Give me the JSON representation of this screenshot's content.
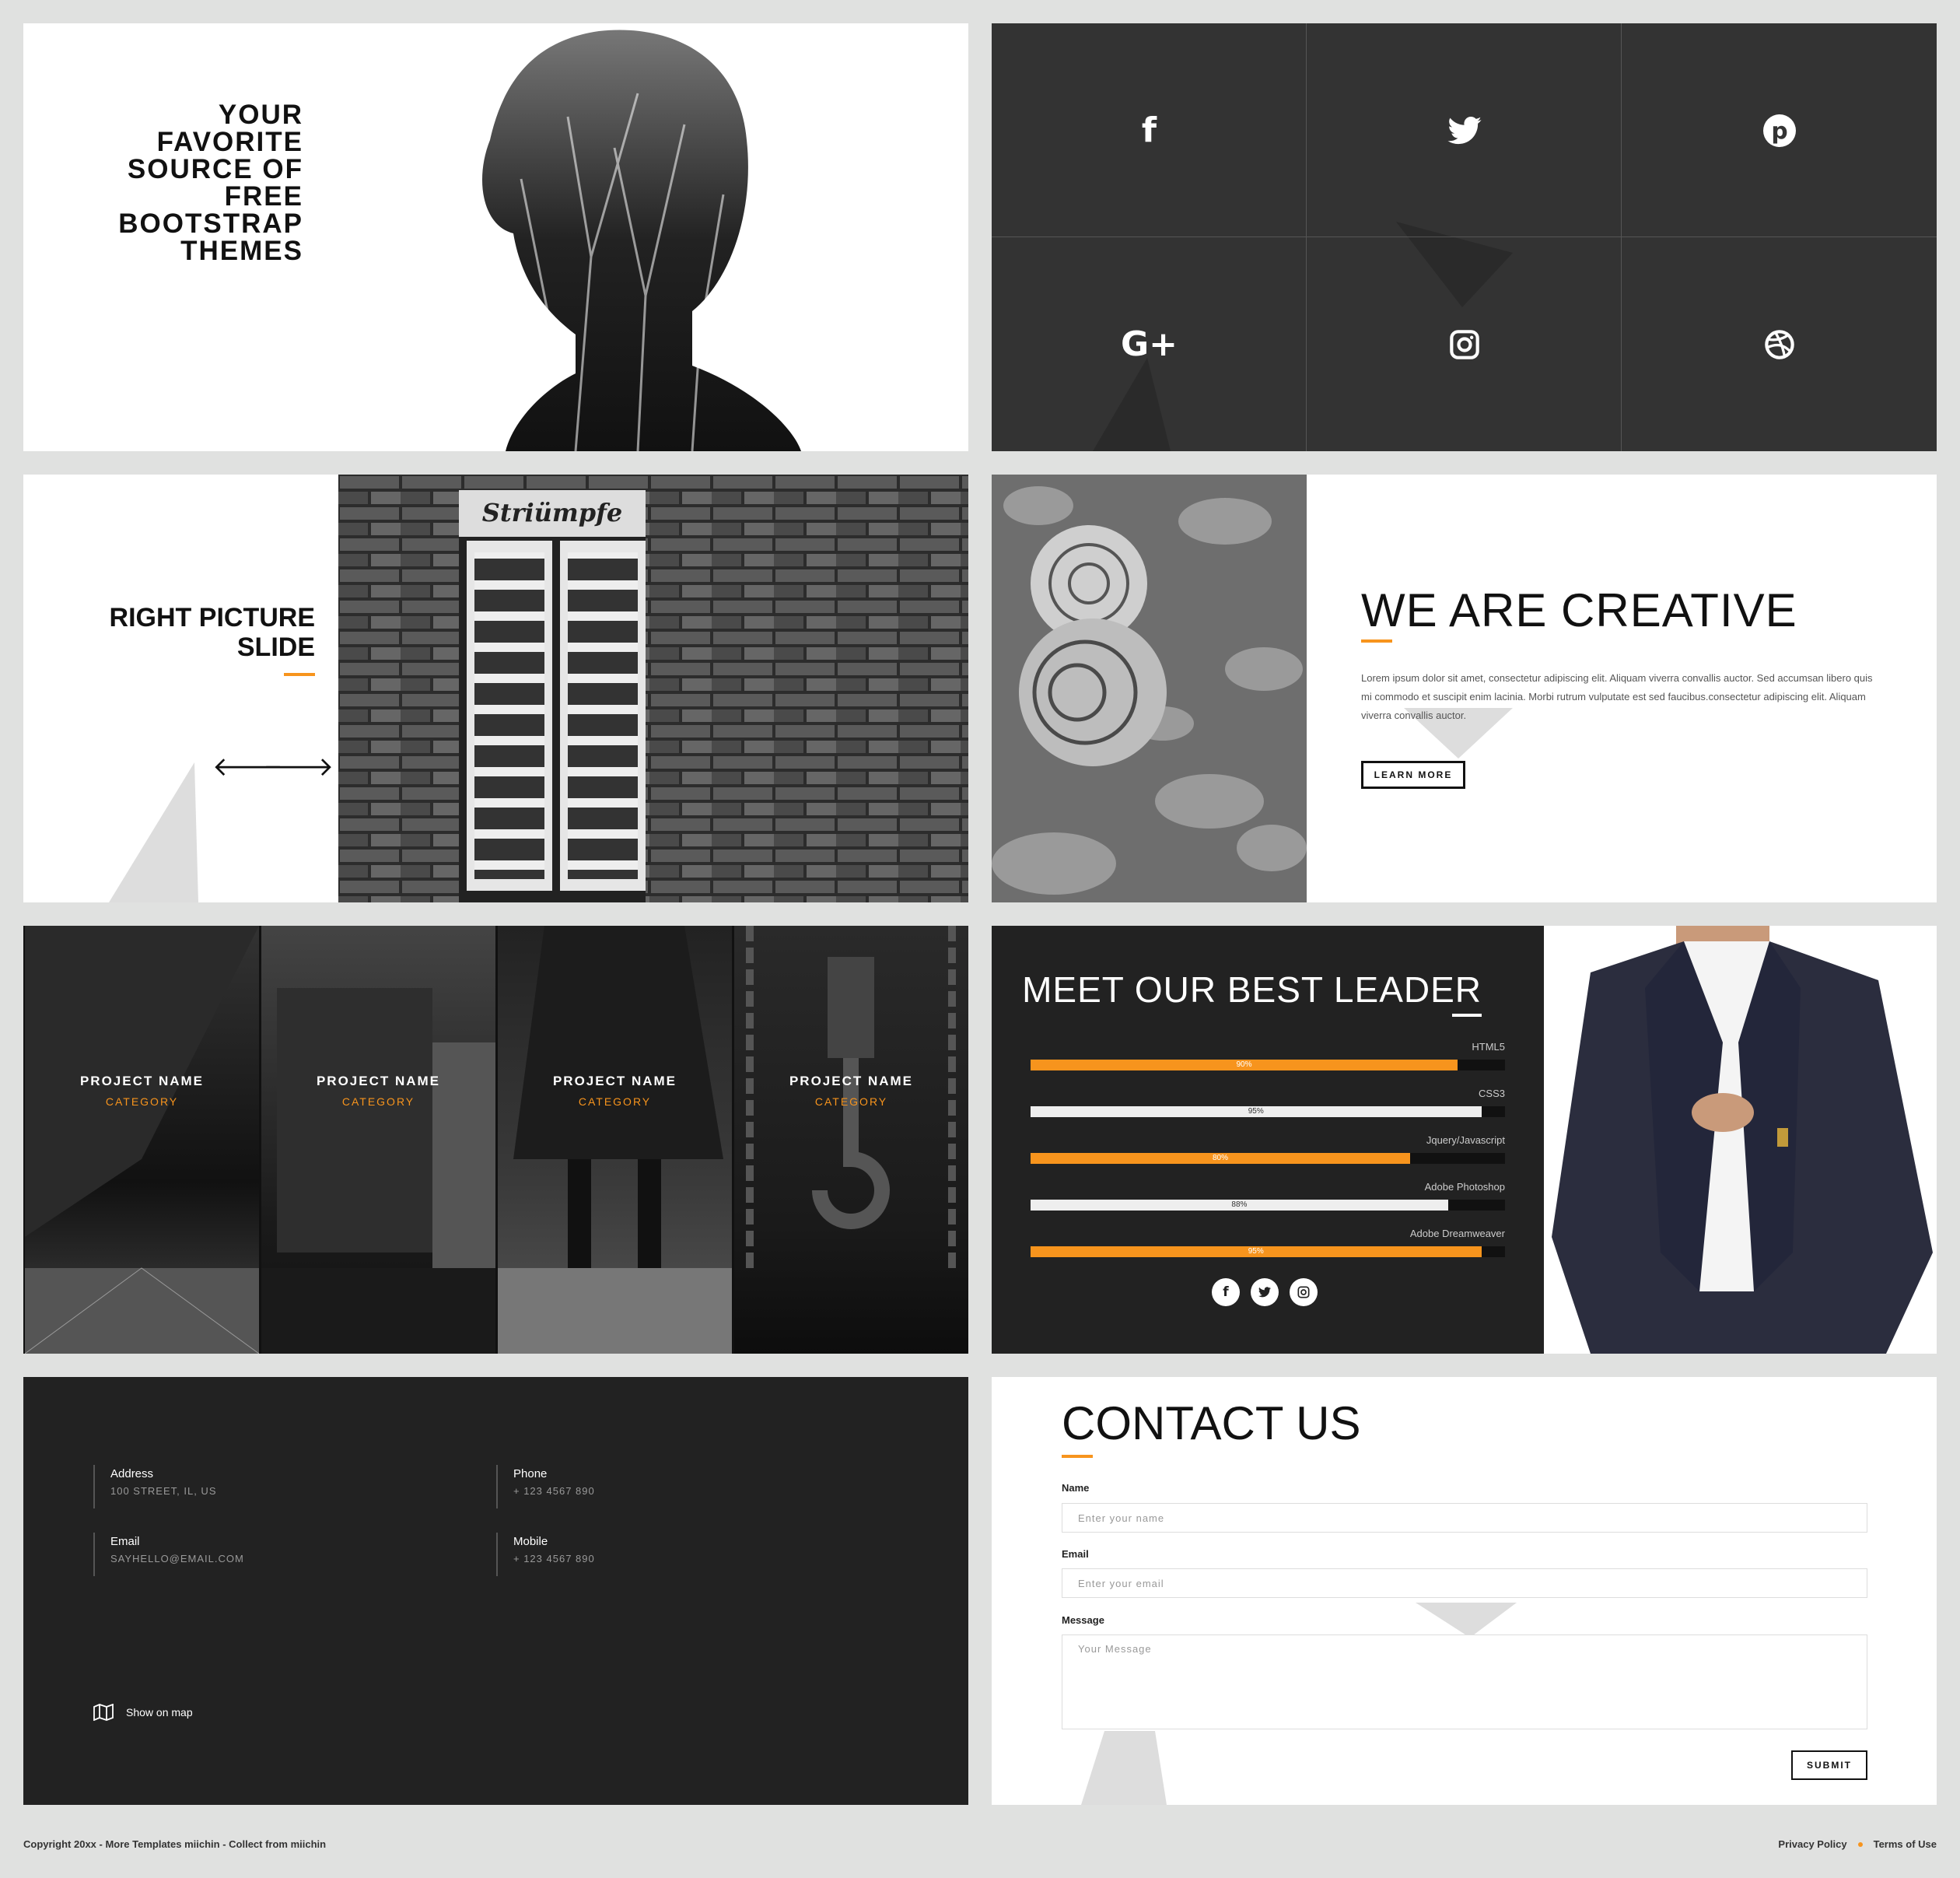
{
  "hero": {
    "title": "YOUR\nFAVORITE\nSOURCE OF\nFREE\nBOOTSTRAP\nTHEMES"
  },
  "social_grid": {
    "icons": [
      "facebook-icon",
      "twitter-icon",
      "pinterest-icon",
      "google-plus-icon",
      "instagram-icon",
      "dribbble-icon"
    ]
  },
  "right_slide": {
    "title": "RIGHT PICTURE\nSLIDE",
    "sign_text": "Striümpfe"
  },
  "creative": {
    "title": "WE ARE CREATIVE",
    "text": "Lorem ipsum dolor sit amet, consectetur adipiscing elit. Aliquam viverra convallis auctor. Sed accumsan libero quis mi commodo et suscipit enim lacinia. Morbi rutrum vulputate est sed faucibus.consectetur adipiscing elit. Aliquam viverra convallis auctor.",
    "button": "LEARN MORE"
  },
  "projects": [
    {
      "name": "PROJECT NAME",
      "category": "CATEGORY"
    },
    {
      "name": "PROJECT NAME",
      "category": "CATEGORY"
    },
    {
      "name": "PROJECT NAME",
      "category": "CATEGORY"
    },
    {
      "name": "PROJECT NAME",
      "category": "CATEGORY"
    }
  ],
  "leader": {
    "title": "MEET OUR BEST LEADER",
    "skills": [
      {
        "name": "HTML5",
        "percent": 90,
        "label": "90%",
        "color": "#f7941d"
      },
      {
        "name": "CSS3",
        "percent": 95,
        "label": "95%",
        "color": "#eeeeee"
      },
      {
        "name": "Jquery/Javascript",
        "percent": 80,
        "label": "80%",
        "color": "#f7941d"
      },
      {
        "name": "Adobe Photoshop",
        "percent": 88,
        "label": "88%",
        "color": "#eeeeee"
      },
      {
        "name": "Adobe Dreamweaver",
        "percent": 95,
        "label": "95%",
        "color": "#f7941d"
      }
    ]
  },
  "contact_info": {
    "address_label": "Address",
    "address_value": "100 STREET, IL, US",
    "phone_label": "Phone",
    "phone_value": "+ 123 4567 890",
    "email_label": "Email",
    "email_value": "SAYHELLO@EMAIL.COM",
    "mobile_label": "Mobile",
    "mobile_value": "+ 123 4567 890",
    "map_link": "Show on map"
  },
  "contact_form": {
    "title": "CONTACT US",
    "name_label": "Name",
    "name_placeholder": "Enter your name",
    "email_label": "Email",
    "email_placeholder": "Enter your email",
    "message_label": "Message",
    "message_placeholder": "Your Message",
    "submit": "SUBMIT"
  },
  "footer": {
    "copyright": "Copyright 20xx - More Templates miichin - Collect from miichin",
    "privacy": "Privacy Policy",
    "terms": "Terms of Use"
  },
  "colors": {
    "accent": "#f7941d",
    "dark": "#222222",
    "panel_dark": "#333333"
  }
}
